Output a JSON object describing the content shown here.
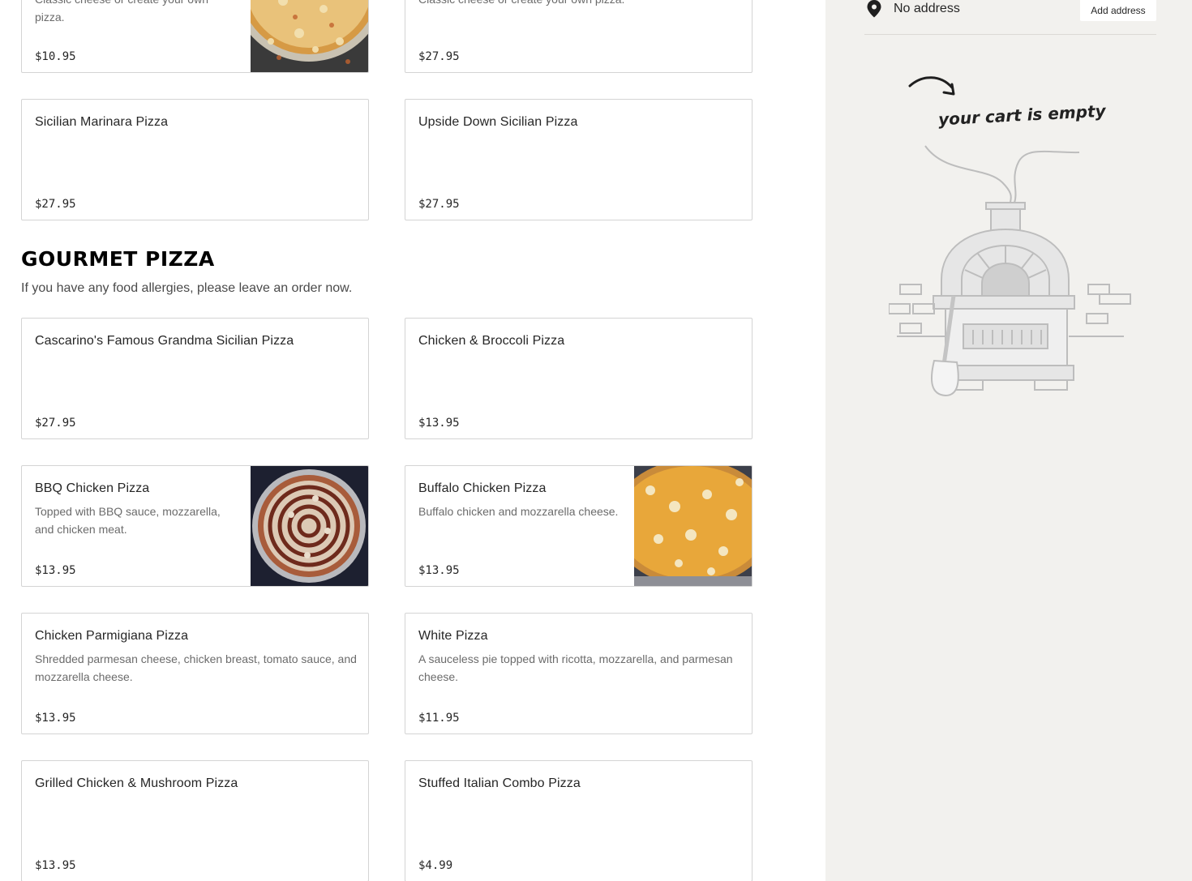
{
  "sections": {
    "upper": {
      "items": [
        {
          "name": "",
          "desc": "Classic cheese or create your own pizza.",
          "price": "$10.95",
          "image": "cheese-pizza-photo"
        },
        {
          "name": "",
          "desc": "Classic cheese or create your own pizza.",
          "price": "$27.95"
        },
        {
          "name": "Sicilian Marinara Pizza",
          "price": "$27.95"
        },
        {
          "name": "Upside Down Sicilian Pizza",
          "price": "$27.95"
        }
      ]
    },
    "gourmet": {
      "title": "GOURMET PIZZA",
      "note": "If you have any food allergies, please leave an order now.",
      "items": [
        {
          "name": "Cascarino's Famous Grandma Sicilian Pizza",
          "price": "$27.95"
        },
        {
          "name": "Chicken & Broccoli Pizza",
          "price": "$13.95"
        },
        {
          "name": "BBQ Chicken Pizza",
          "desc": "Topped with BBQ sauce, mozzarella, and chicken meat.",
          "price": "$13.95",
          "image": "bbq-chicken-pizza-photo"
        },
        {
          "name": "Buffalo Chicken Pizza",
          "desc": "Buffalo chicken and mozzarella cheese.",
          "price": "$13.95",
          "image": "buffalo-chicken-pizza-photo"
        },
        {
          "name": "Chicken Parmigiana Pizza",
          "desc": "Shredded parmesan cheese, chicken breast, tomato sauce, and mozzarella cheese.",
          "price": "$13.95"
        },
        {
          "name": "White Pizza",
          "desc": "A sauceless pie topped with ricotta, mozzarella, and parmesan cheese.",
          "price": "$11.95"
        },
        {
          "name": "Grilled Chicken & Mushroom Pizza",
          "price": "$13.95"
        },
        {
          "name": "Stuffed Italian Combo Pizza",
          "price": "$4.99"
        }
      ]
    }
  },
  "sidebar": {
    "address": "No address",
    "add_address": "Add address",
    "empty_cart": "your cart is empty",
    "icons": {
      "location": "map-pin-icon",
      "illustration": "pizza-oven-illustration"
    }
  },
  "colors": {
    "card_border": "#d4d4d4",
    "sidebar_bg": "#f2f1ee",
    "text": "#262626",
    "muted": "#6b6b6b"
  }
}
